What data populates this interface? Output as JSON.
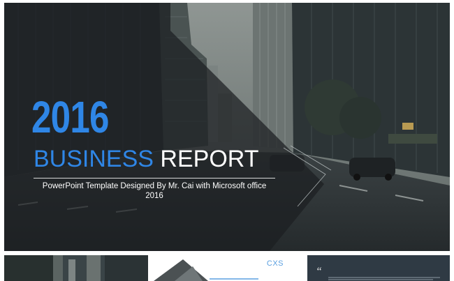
{
  "slide": {
    "year": "2016",
    "title_word1": "BUSINESS",
    "title_word2": "REPORT",
    "subtitle_line1": "PowerPoint Template Designed By Mr. Cai with Microsoft office",
    "subtitle_line2": "2016",
    "colors": {
      "accent": "#2f86e6",
      "text": "#ffffff",
      "overlay": "#1c1f21"
    }
  },
  "thumbnails": {
    "t2_brand": "CXS",
    "t3_quote_mark": "“"
  }
}
